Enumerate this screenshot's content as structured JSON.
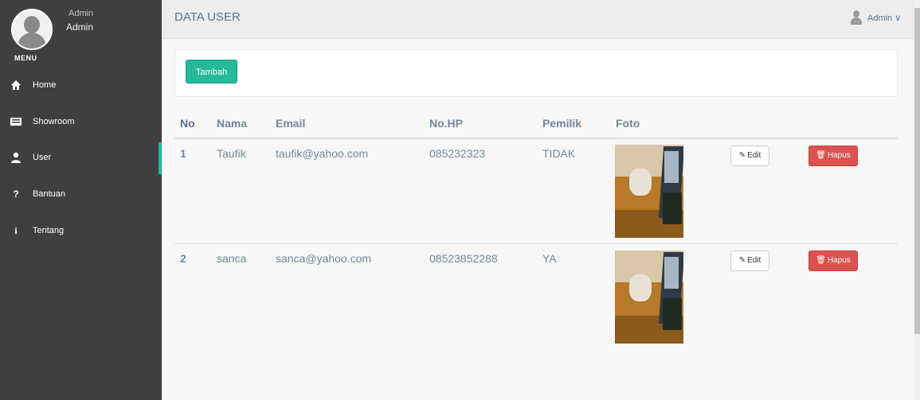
{
  "sidebar": {
    "profile_role": "Admin",
    "profile_name": "Admin",
    "menu_title": "MENU",
    "items": [
      {
        "label": "Home",
        "icon": "home-icon"
      },
      {
        "label": "Showroom",
        "icon": "showroom-icon"
      },
      {
        "label": "User",
        "icon": "user-icon"
      },
      {
        "label": "Bantuan",
        "icon": "question-icon"
      },
      {
        "label": "Tentang",
        "icon": "info-icon"
      }
    ],
    "active_index": 2,
    "accent_color": "#1abb9c"
  },
  "header": {
    "title": "DATA USER",
    "user_label": "Admin ∨"
  },
  "toolbar": {
    "add_label": "Tambah"
  },
  "table": {
    "columns": [
      "No",
      "Nama",
      "Email",
      "No.HP",
      "Pemilik",
      "Foto"
    ],
    "rows": [
      {
        "no": "1",
        "nama": "Taufik",
        "email": "taufik@yahoo.com",
        "hp": "085232323",
        "pemilik": "TIDAK",
        "edit_label": "Edit",
        "delete_label": "Hapus"
      },
      {
        "no": "2",
        "nama": "sanca",
        "email": "sanca@yahoo.com",
        "hp": "08523852288",
        "pemilik": "YA",
        "edit_label": "Edit",
        "delete_label": "Hapus"
      }
    ]
  },
  "colors": {
    "add_button": "#26b99a",
    "delete_button": "#d9534f",
    "sidebar_bg": "#3f3f3f"
  }
}
